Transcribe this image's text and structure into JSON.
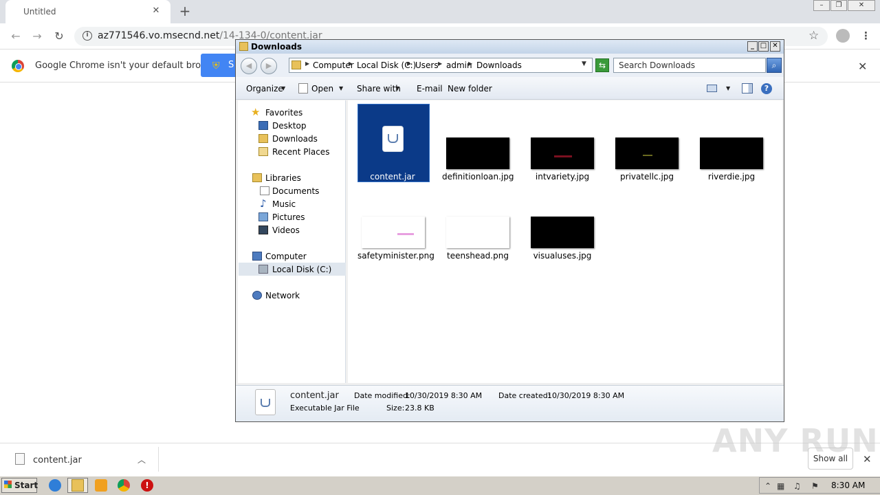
{
  "browser": {
    "tab_title": "Untitled",
    "url_host": "az771546.vo.msecnd.net",
    "url_path": "/14-134-0/content.jar",
    "infobar_text": "Google Chrome isn't your default browser",
    "set_default_label": "S",
    "download_file": "content.jar",
    "show_all_label": "Show all"
  },
  "explorer": {
    "title": "Downloads",
    "breadcrumbs": [
      "Computer",
      "Local Disk (C:)",
      "Users",
      "admin",
      "Downloads"
    ],
    "search_placeholder": "Search Downloads",
    "toolbar": {
      "organize": "Organize",
      "open": "Open",
      "share_with": "Share with",
      "email": "E-mail",
      "new_folder": "New folder"
    },
    "nav": {
      "favorites": "Favorites",
      "desktop": "Desktop",
      "downloads": "Downloads",
      "recent": "Recent Places",
      "libraries": "Libraries",
      "documents": "Documents",
      "music": "Music",
      "pictures": "Pictures",
      "videos": "Videos",
      "computer": "Computer",
      "local_disk": "Local Disk (C:)",
      "network": "Network"
    },
    "files": [
      {
        "name": "content.jar",
        "selected": true
      },
      {
        "name": "definitionloan.jpg"
      },
      {
        "name": "intvariety.jpg"
      },
      {
        "name": "privatellc.jpg"
      },
      {
        "name": "riverdie.jpg"
      },
      {
        "name": "safetyminister.png"
      },
      {
        "name": "teenshead.png"
      },
      {
        "name": "visualuses.jpg"
      }
    ],
    "status": {
      "name": "content.jar",
      "type": "Executable Jar File",
      "modified_label": "Date modified:",
      "modified": "10/30/2019 8:30 AM",
      "created_label": "Date created:",
      "created": "10/30/2019 8:30 AM",
      "size_label": "Size:",
      "size": "23.8 KB"
    }
  },
  "taskbar": {
    "start": "Start",
    "clock": "8:30 AM"
  },
  "watermark": "ANY RUN"
}
